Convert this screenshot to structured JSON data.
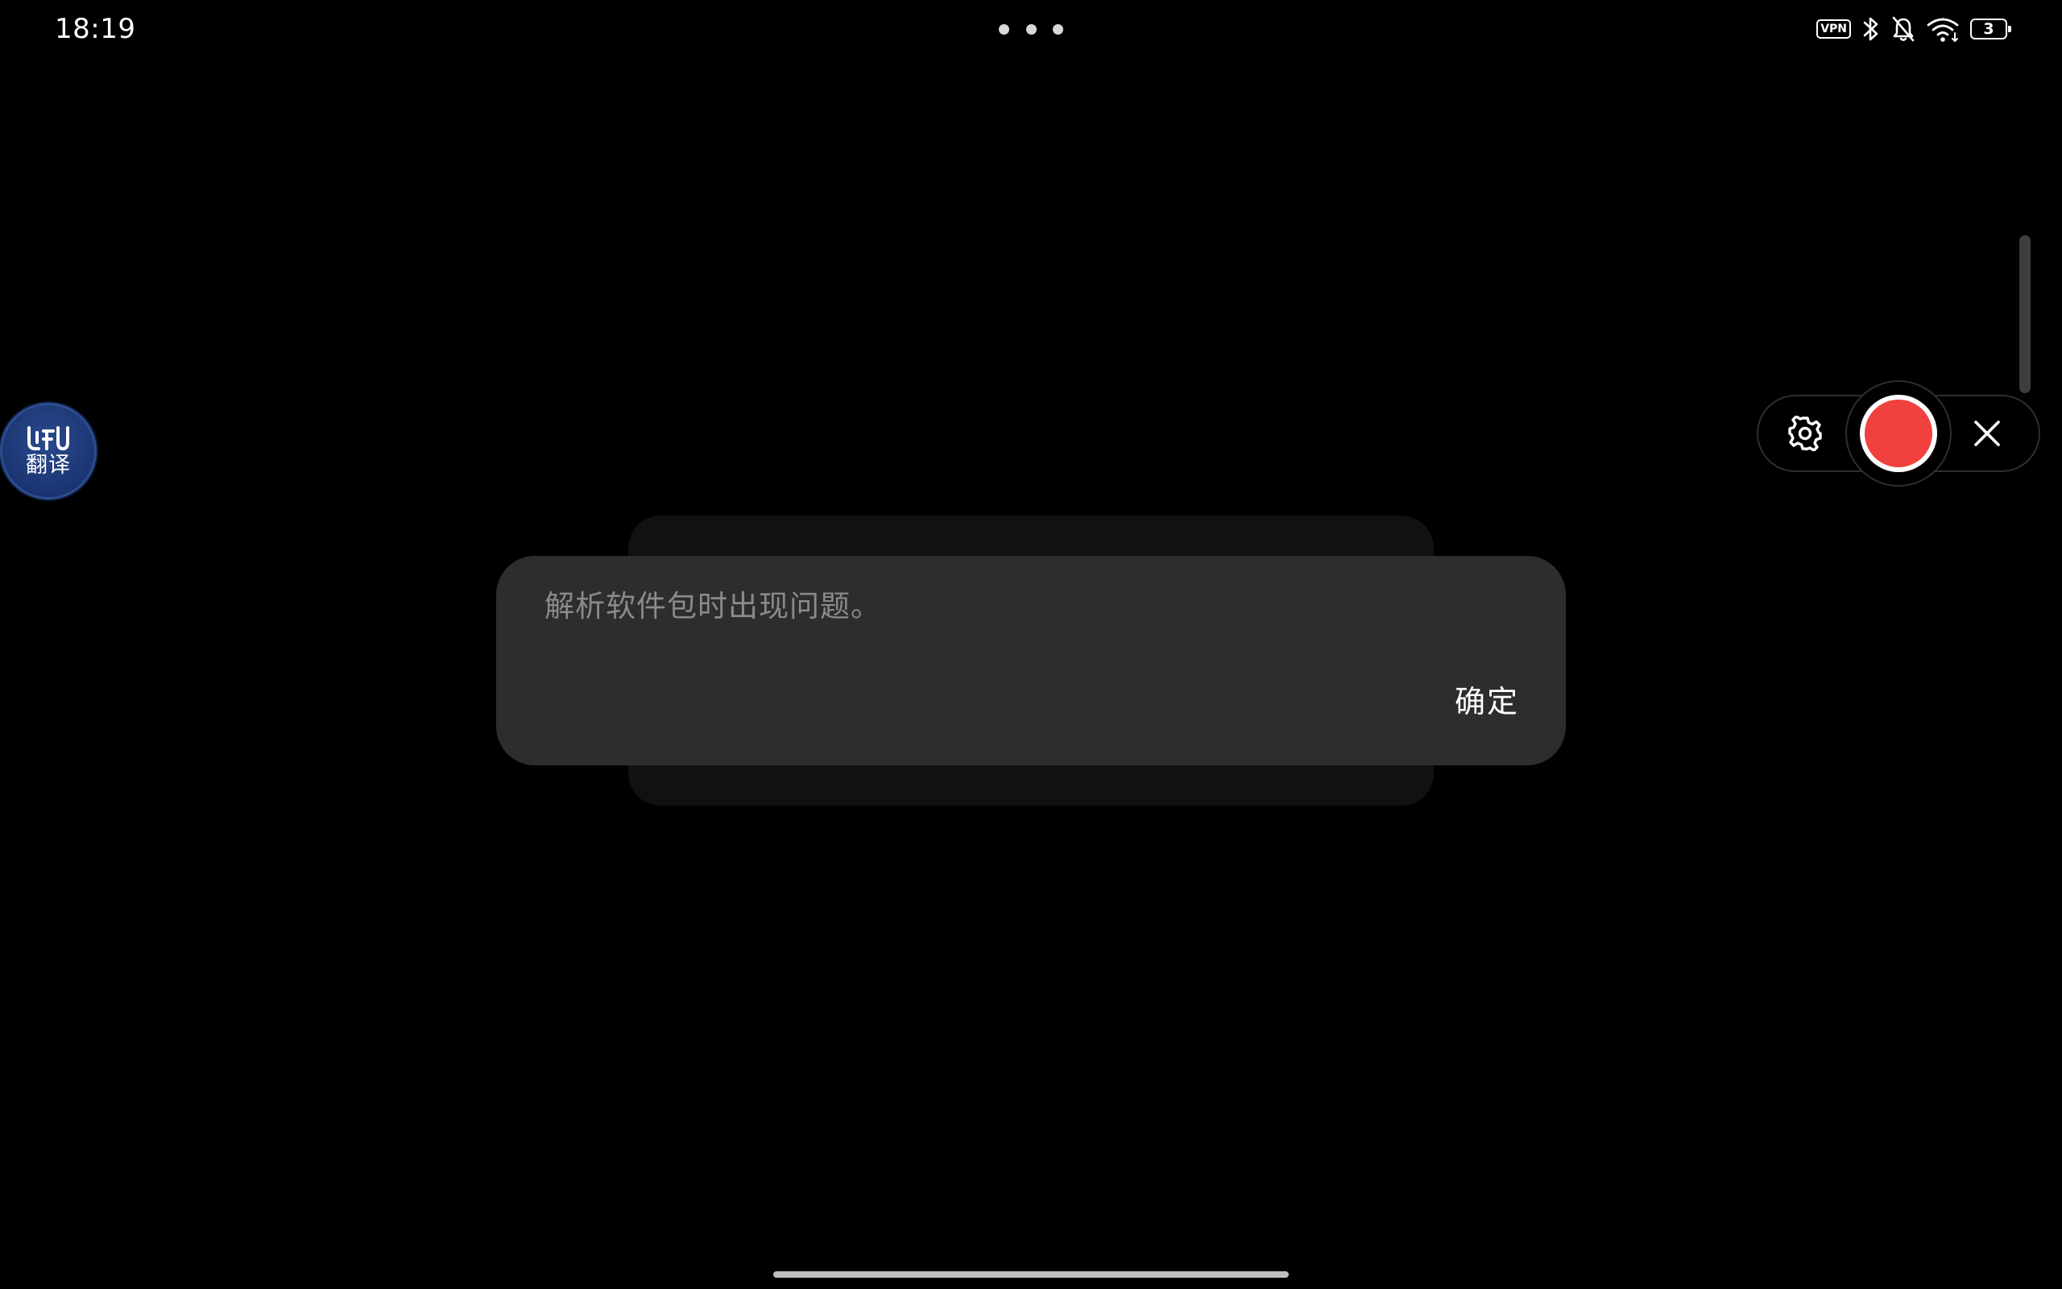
{
  "status_bar": {
    "time": "18:19",
    "vpn_label": "VPN",
    "battery_level": "3",
    "icons": [
      "vpn-icon",
      "bluetooth-icon",
      "bell-off-icon",
      "wifi-icon",
      "battery-icon"
    ]
  },
  "floating_translate": {
    "label": "翻译",
    "icon": "translate-logo-icon"
  },
  "record_toolbar": {
    "settings_icon": "gear-icon",
    "record_icon": "record-icon",
    "close_icon": "close-icon",
    "record_color": "#f0413e"
  },
  "dialog": {
    "message": "解析软件包时出现问题。",
    "ok_label": "确定"
  },
  "colors": {
    "background": "#000000",
    "dialog_background": "#2d2d2d",
    "message_text": "#8a8a8a",
    "translate_bubble": "#1b3470"
  }
}
